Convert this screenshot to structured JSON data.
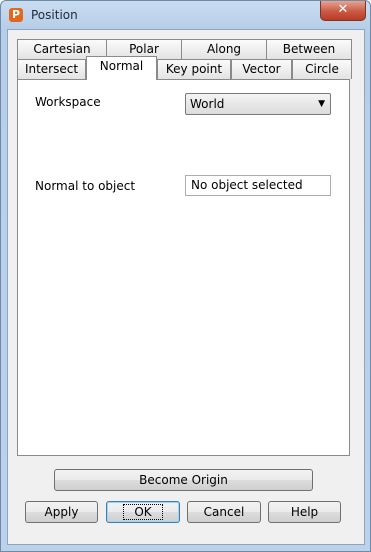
{
  "window": {
    "title": "Position",
    "app_icon_letter": "P",
    "close_label": "✕"
  },
  "tabs": {
    "row1": [
      "Cartesian",
      "Polar",
      "Along",
      "Between"
    ],
    "row2": [
      "Intersect",
      "Normal",
      "Key point",
      "Vector",
      "Circle"
    ],
    "active": "Normal"
  },
  "form": {
    "workspace_label": "Workspace",
    "workspace_value": "World",
    "normal_label": "Normal to object",
    "normal_value": "No object selected"
  },
  "buttons": {
    "become_origin": "Become Origin",
    "apply": "Apply",
    "ok": "OK",
    "cancel": "Cancel",
    "help": "Help"
  }
}
